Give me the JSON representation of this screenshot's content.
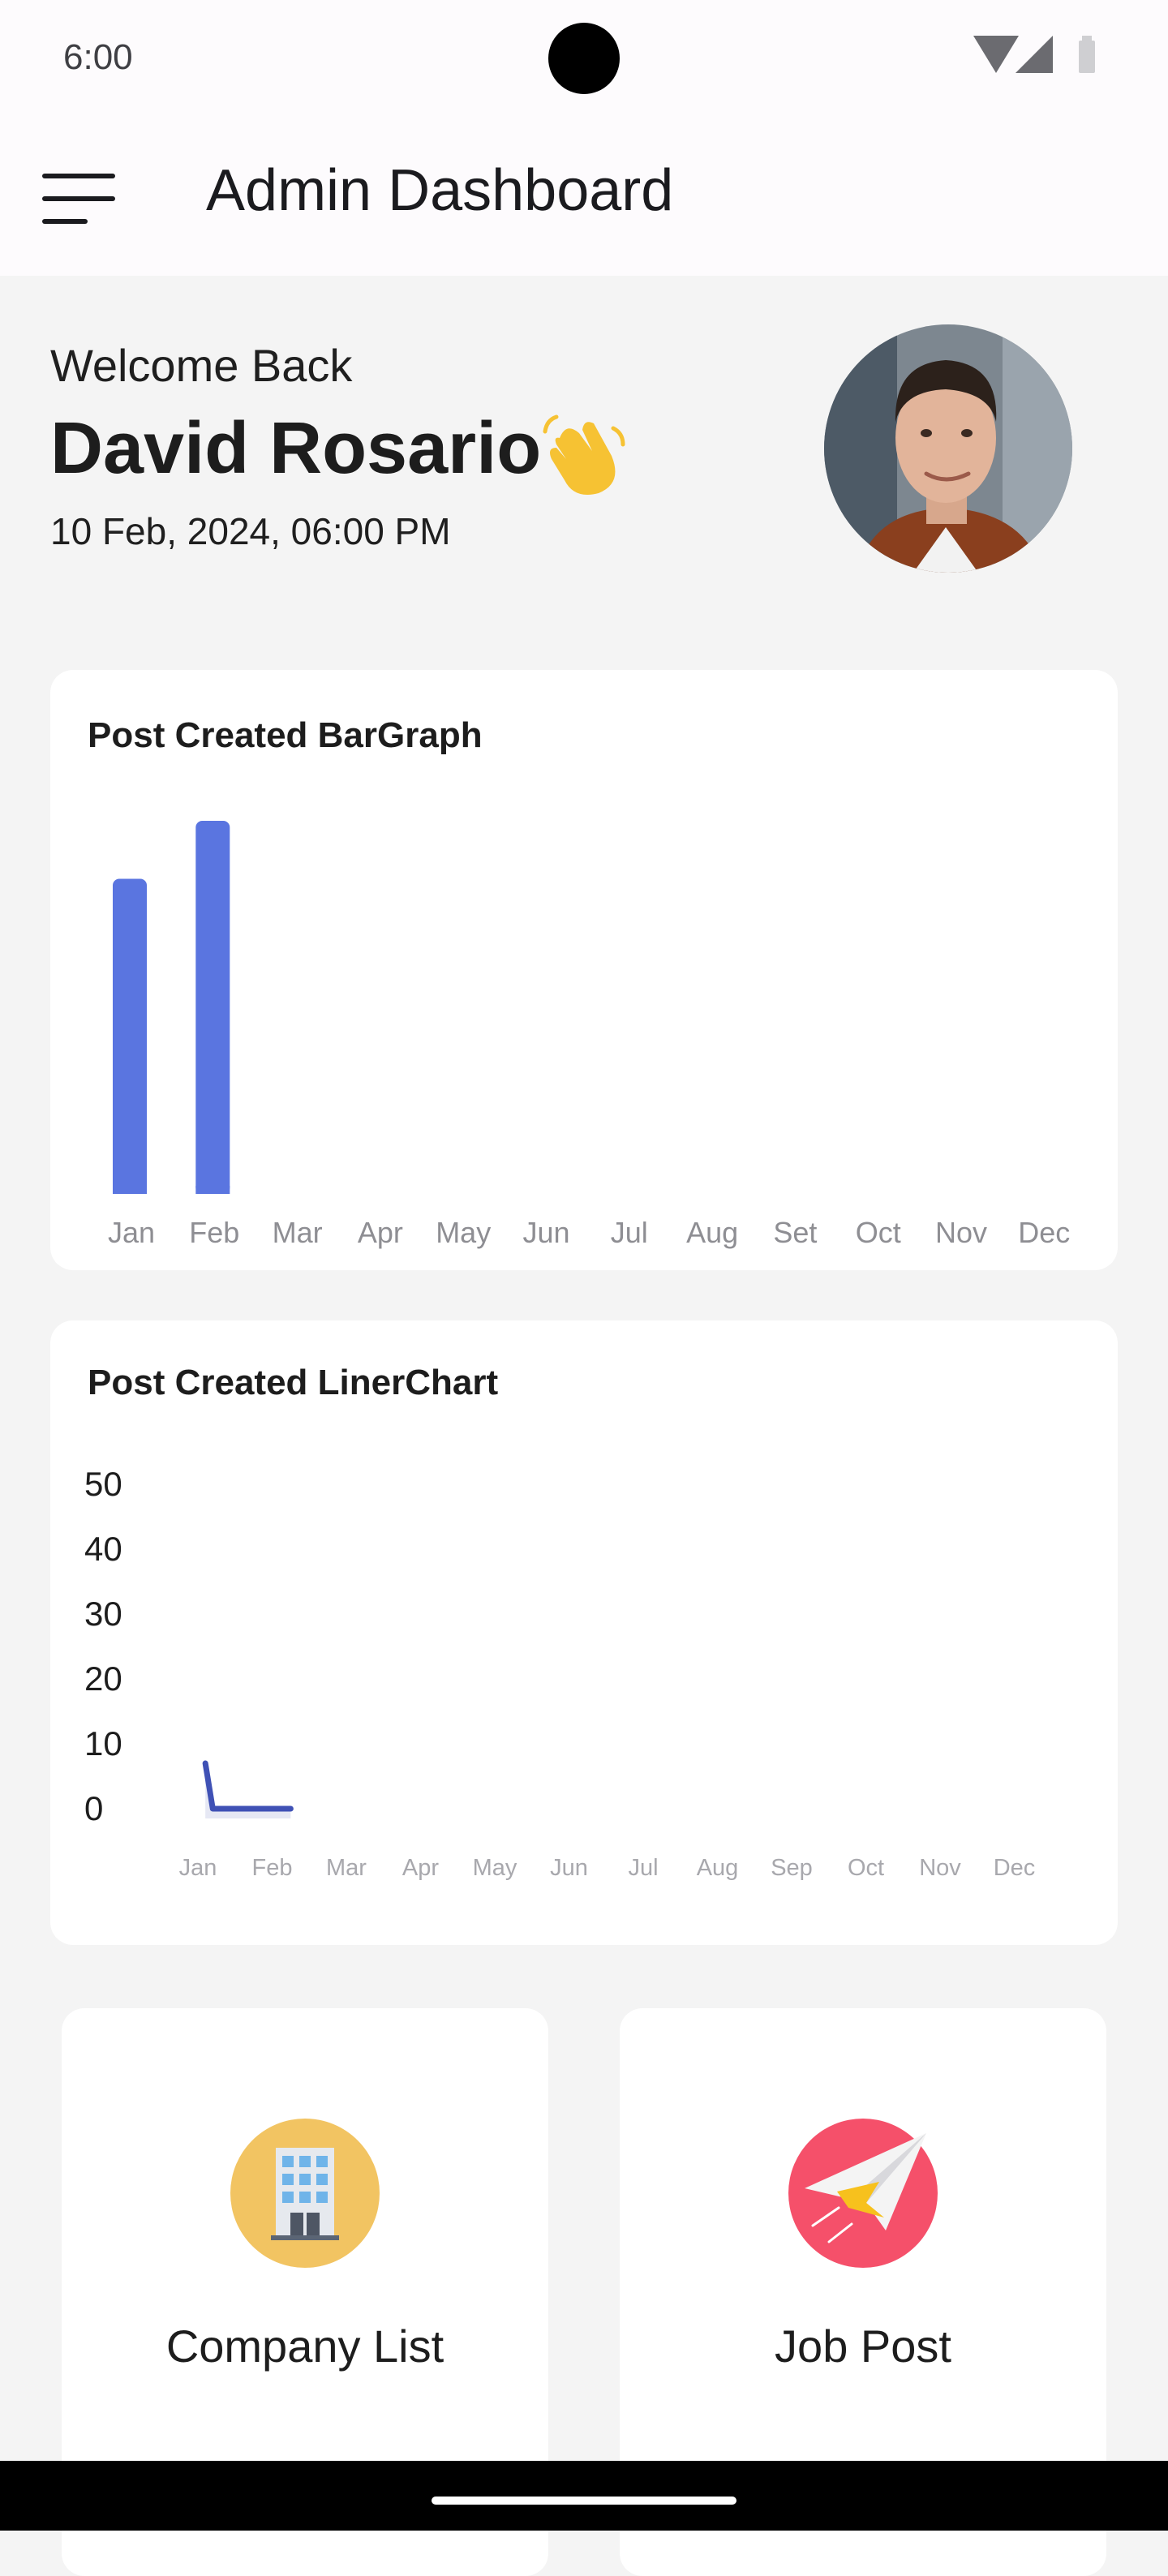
{
  "status_bar": {
    "time": "6:00"
  },
  "app_bar": {
    "title": "Admin Dashboard"
  },
  "welcome": {
    "label": "Welcome Back",
    "name": "David Rosario",
    "datetime": "10 Feb, 2024, 06:00 PM"
  },
  "bar_card": {
    "title": "Post Created BarGraph"
  },
  "line_card": {
    "title": "Post Created LinerChart"
  },
  "chart_data": [
    {
      "type": "bar",
      "title": "Post Created BarGraph",
      "categories": [
        "Jan",
        "Feb",
        "Mar",
        "Apr",
        "May",
        "Jun",
        "Jul",
        "Aug",
        "Set",
        "Oct",
        "Nov",
        "Dec"
      ],
      "values": [
        38,
        45,
        0,
        0,
        0,
        0,
        0,
        0,
        0,
        0,
        0,
        0
      ],
      "ylim": [
        0,
        45
      ],
      "grid": false,
      "color": "#5a75e0"
    },
    {
      "type": "line",
      "title": "Post Created LinerChart",
      "categories": [
        "Jan",
        "Feb",
        "Mar",
        "Apr",
        "May",
        "Jun",
        "Jul",
        "Aug",
        "Sep",
        "Oct",
        "Nov",
        "Dec"
      ],
      "yticks": [
        "50",
        "40",
        "30",
        "20",
        "10",
        "0"
      ],
      "ylim": [
        0,
        50
      ],
      "x": [
        0.1,
        0.2,
        1.25
      ],
      "values": [
        7,
        0,
        0
      ],
      "grid": false,
      "color": "#3f51b5"
    }
  ],
  "tiles": [
    {
      "label": "Company List",
      "icon": "office-building-icon",
      "bg": "#f2c462"
    },
    {
      "label": "Job Post",
      "icon": "paper-plane-icon",
      "bg": "#f5506a"
    }
  ]
}
